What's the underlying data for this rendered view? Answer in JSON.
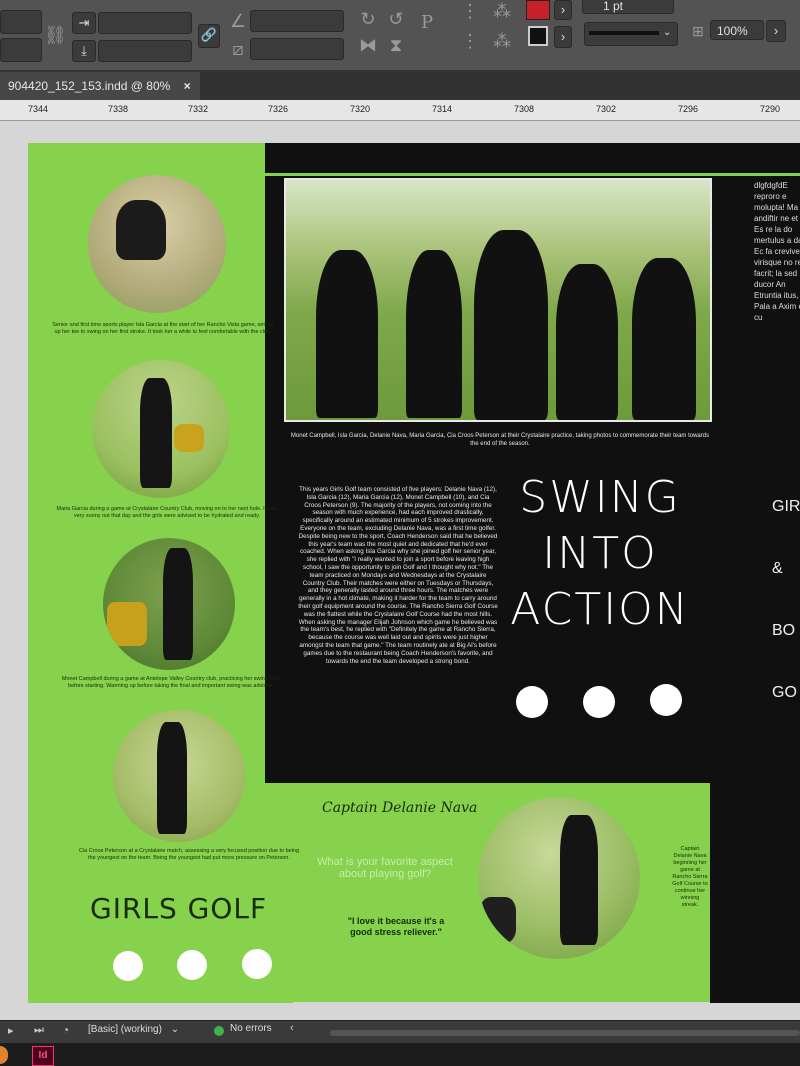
{
  "app": {
    "doc_tab": "904420_152_153.indd @ 80%",
    "tab_close": "×",
    "stroke_weight": "1 pt",
    "zoom": "100%",
    "colors": {
      "accent_green": "#86d24c",
      "dark_bg": "#101010",
      "swatch_red": "#c8202a"
    }
  },
  "ruler": {
    "ticks": [
      "7344",
      "7338",
      "7332",
      "7326",
      "7320",
      "7314",
      "7308",
      "7302",
      "7296",
      "7290"
    ]
  },
  "spread": {
    "captions": [
      "Senior and first time sports player Isla Garcia at the start of her Rancho Vista game, setting up her tee to swing on her first stroke. It took her a while to feel comfortable with the club.",
      "Maria Garcia during a game at Crystalaire Country Club, moving on to her next hole. It was very sunny out that day and the girls were advised to be hydrated and ready.",
      "Monet Campbell during a game at Antelope Valley Country club, practicing her swing right before starting. Warming up before taking the final and important swing was advised.",
      "Cia Croos Peterson at a Crystalaire match, assessing a very focused position due to being the youngest on the team. Being the youngest had put more pressure on Peterson."
    ],
    "group_caption": "Monet Campbell, Isla Garcia, Delanie Nava, Maria Garcia, Cia Croos Peterson at their Crystalaire practice, taking photos to commemorate their team towards the end of the season.",
    "body": "This years Girls Golf team consisted of five players: Delanie Nava (12), Isla Garcia (12), Maria Garcia (12), Monet Campbell (10), and Cia Croos Peterson (9). The majority of the players, not coming into the season with much experience, had each improved drastically, specifically around an estimated minimum of 5 strokes improvement. Everyone on the team, excluding Delanie Nava, was a first time golfer. Despite being new to the sport, Coach Henderson said that he believed this year's team was the most quiet and dedicated that he'd ever coached. When asking Isla Garcia why she joined golf her senior year, she replied with \"I really wanted to join a sport before leaving high school, I saw the opportunity to join Golf and I thought why not.\" The team practiced on Mondays and Wednesdays at the Crystalaire Country Club. Their matches were either on Tuesdays or Thursdays, and they generally lasted around three hours. The matches were generally in a hot climate, making it harder for the team to carry around their golf equipment around the course. The Rancho Sierra Golf Course was the flattest while the Crystalaire Golf Course had the most hills. When asking the manager Elijah Johnson which game he believed was the team's best, he replied with \"Definitely the game at Rancho Sierra, because the course was well laid out and spirits were just higher amongst the team that game.\" The team routinely ate at Big Al's before games due to the restaurant being Coach Henderson's favorite, and towards the end the team developed a strong bond.",
    "title_lines": [
      "SWING",
      "INTO",
      "ACTION"
    ],
    "girls_golf": "GIRLS GOLF",
    "captain_heading": "Captain Delanie Nava",
    "question": "What is your favorite aspect about playing golf?",
    "quote": "\"I love it because it's a good stress reliever.\"",
    "captain_caption": "Captain Delanie Nava beginning her game at Rancho Sierra Golf Course to continue her winning streak.",
    "right_peek_text": "dlgfdgfdE reproro e molupta! Ma andiftir ne et qua Es re la do mertulus a dam. Ec fa crevivertis virisque no rei facrit; la sed ducor An Etruntia itus, Pala a Axim es cu",
    "right_headings": [
      "GIR",
      "&",
      "BO",
      "GO"
    ]
  },
  "status": {
    "style": "[Basic] (working)",
    "errors": "No errors"
  },
  "taskbar": {
    "app_icon": "Id"
  }
}
